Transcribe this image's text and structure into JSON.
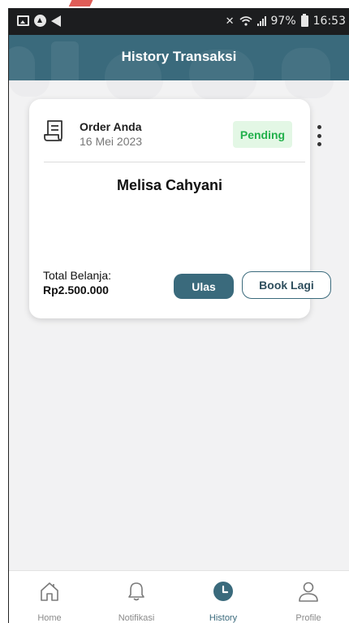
{
  "status_bar": {
    "battery": "97%",
    "time": "16:53"
  },
  "header": {
    "title": "History Transaksi"
  },
  "order": {
    "label": "Order Anda",
    "date": "16 Mei 2023",
    "status": "Pending",
    "customer": "Melisa Cahyani",
    "total_label": "Total Belanja:",
    "total_amount": "Rp2.500.000",
    "review_label": "Ulas",
    "rebook_label": "Book Lagi"
  },
  "bottom_nav": {
    "items": [
      {
        "label": "Home",
        "icon": "home-icon",
        "active": false
      },
      {
        "label": "Notifikasi",
        "icon": "bell-icon",
        "active": false
      },
      {
        "label": "History",
        "icon": "clock-icon",
        "active": true
      },
      {
        "label": "Profile",
        "icon": "user-icon",
        "active": false
      }
    ]
  },
  "colors": {
    "primary": "#3a6a7c",
    "status_bar": "#1c1d1f",
    "pending_text": "#22b04b",
    "pending_bg": "#e3f7e5",
    "background": "#f2f2f3"
  }
}
